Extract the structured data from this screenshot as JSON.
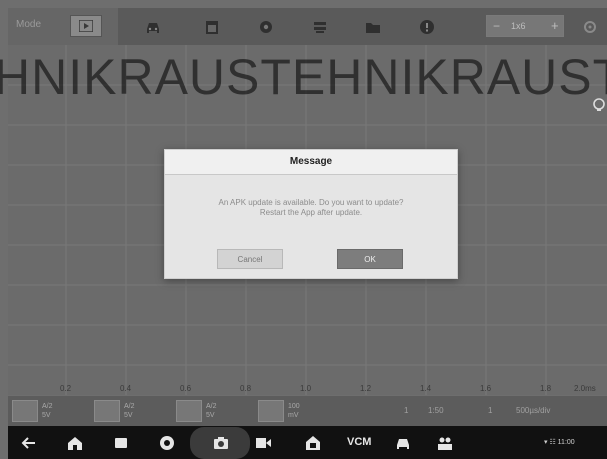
{
  "topbar": {
    "left_label": "Mode",
    "zoom": {
      "minus": "−",
      "value": "1x6",
      "plus": "+"
    },
    "icons": [
      "play-icon",
      "car-icon",
      "calendar-icon",
      "gear-icon",
      "filter-icon",
      "folder-icon",
      "help-icon",
      "settings-icon"
    ]
  },
  "watermark": {
    "text": "HNIKRAUSTEHNIKRAUSTE"
  },
  "axis": {
    "ticks": [
      "0.2",
      "0.4",
      "0.6",
      "0.8",
      "1.0",
      "1.2",
      "1.4",
      "1.6",
      "1.8",
      "2.0ms"
    ]
  },
  "channels": [
    {
      "name": "ch-a",
      "line1": "A/2",
      "line2": "5V"
    },
    {
      "name": "ch-b",
      "line1": "A/2",
      "line2": "5V"
    },
    {
      "name": "ch-c",
      "line1": "A/2",
      "line2": "5V"
    },
    {
      "name": "ch-d",
      "line1": "100",
      "line2": "mV"
    }
  ],
  "readouts": {
    "r1": "1",
    "r2": "1:50",
    "r3": "1",
    "r4": "500µs/div"
  },
  "dialog": {
    "title": "Message",
    "message_line1": "An APK update is available. Do you want to update?",
    "message_line2": "Restart the App after update.",
    "cancel_label": "Cancel",
    "ok_label": "OK"
  },
  "navbar": {
    "vci_label": "VCM",
    "status_text": "▾ ☷ 11:00"
  },
  "colors": {
    "background": "#6b6b6b",
    "dialog": "#e5e5e5",
    "ok_button": "#7d7d7d",
    "navbar": "#111111"
  }
}
